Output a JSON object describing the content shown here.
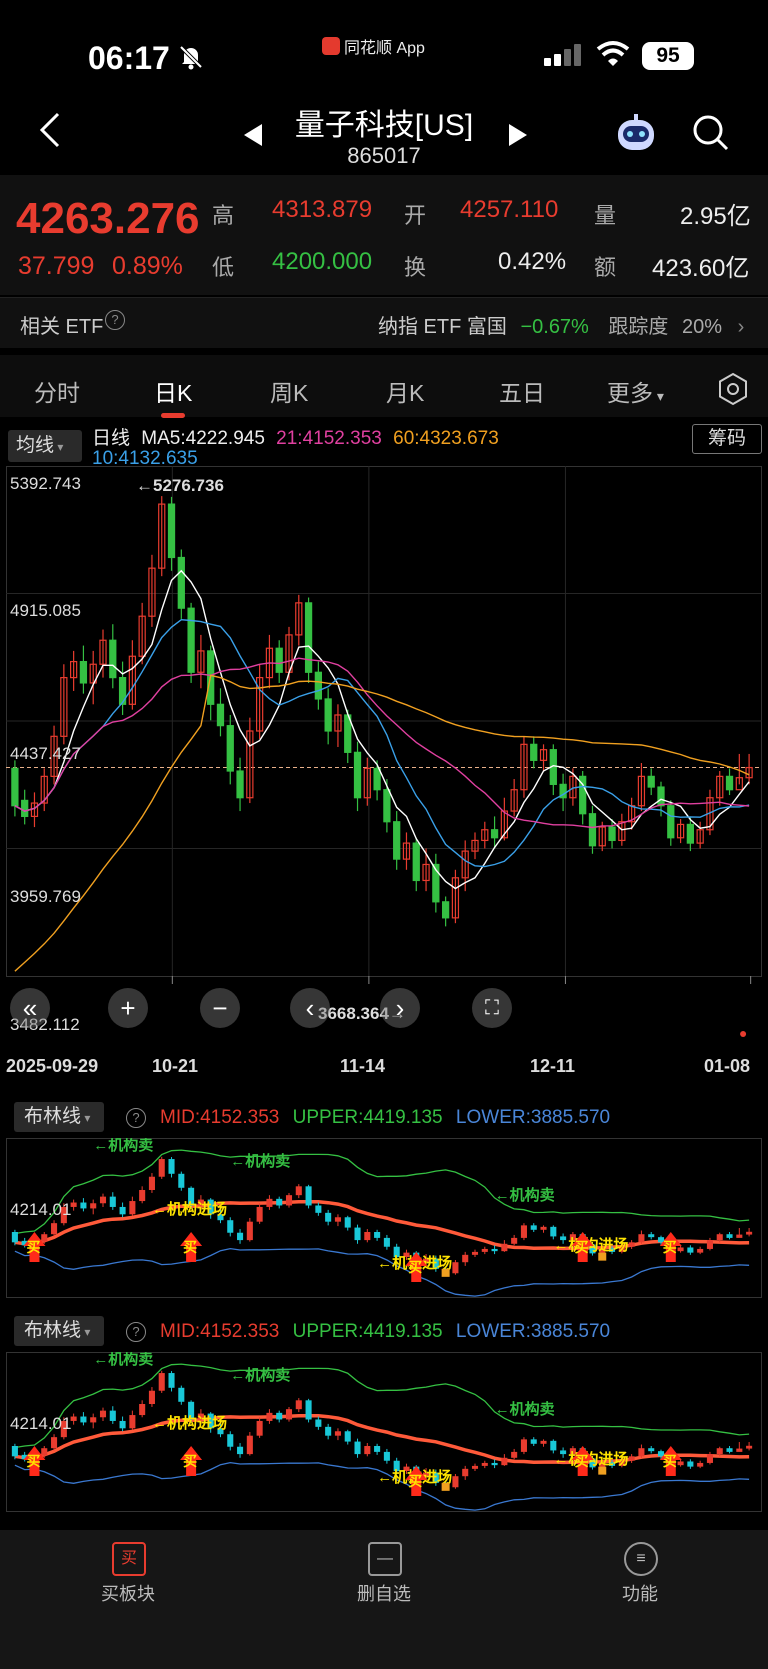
{
  "status": {
    "time": "06:17",
    "app_badge": "同花顺 App",
    "battery": "95"
  },
  "nav": {
    "title": "量子科技[US]",
    "code": "865017"
  },
  "quote": {
    "price": "4263.276",
    "change": "37.799",
    "change_pct": "0.89%",
    "high_label": "高",
    "high": "4313.879",
    "open_label": "开",
    "open": "4257.110",
    "vol_label": "量",
    "vol": "2.95亿",
    "low_label": "低",
    "low": "4200.000",
    "turn_label": "换",
    "turn": "0.42%",
    "amt_label": "额",
    "amt": "423.60亿"
  },
  "etf": {
    "label": "相关 ETF",
    "q": "?",
    "name": "纳指 ETF 富国",
    "pct": "−0.67%",
    "track_label": "跟踪度",
    "track": "20%"
  },
  "tabs": [
    "分时",
    "日K",
    "周K",
    "月K",
    "五日",
    "更多"
  ],
  "ma": {
    "selector": "均线",
    "line_label": "日线",
    "ma5": "MA5:4222.945",
    "ma21": "21:4152.353",
    "ma60": "60:4323.673",
    "ma10": "10:4132.635",
    "chip": "筹码"
  },
  "price_axis": [
    "5392.743",
    "4915.085",
    "4437.427",
    "3959.769",
    "3482.112"
  ],
  "annotations": {
    "high": "←5276.736",
    "low": "3668.364→"
  },
  "x_axis": [
    "2025-09-29",
    "10-21",
    "11-14",
    "12-11",
    "01-08"
  ],
  "indicators": [
    {
      "selector": "布林线",
      "mid": "MID:4152.353",
      "upper": "UPPER:4419.135",
      "lower": "LOWER:3885.570",
      "ylabel": "4214.01",
      "signals": {
        "sell": "←机构卖",
        "enter": "←机构进场",
        "buy": "买"
      }
    },
    {
      "selector": "布林线",
      "mid": "MID:4152.353",
      "upper": "UPPER:4419.135",
      "lower": "LOWER:3885.570",
      "ylabel": "4214.01",
      "signals": {
        "sell": "←机构卖",
        "enter": "←机构进场",
        "buy": "买"
      }
    }
  ],
  "bottom": [
    {
      "label": "买板块",
      "icon": "买"
    },
    {
      "label": "删自选",
      "icon": "—"
    },
    {
      "label": "功能",
      "icon": "≡"
    }
  ],
  "colors": {
    "up": "#e83c2f",
    "down": "#35c043",
    "ma5": "#ffffff",
    "ma10": "#3aa0e8",
    "ma21": "#e040a0",
    "ma60": "#f0a020",
    "cyan": "#19c8d8"
  },
  "chart_data": {
    "type": "candlestick",
    "ylim": [
      3482.112,
      5392.743
    ],
    "x_labels": [
      "2025-09-29",
      "10-21",
      "11-14",
      "12-11",
      "01-08"
    ],
    "candles": [
      [
        4260,
        4120,
        4290,
        4080
      ],
      [
        4140,
        4080,
        4180,
        4050
      ],
      [
        4080,
        4130,
        4170,
        4040
      ],
      [
        4130,
        4230,
        4260,
        4100
      ],
      [
        4230,
        4380,
        4420,
        4200
      ],
      [
        4380,
        4600,
        4650,
        4350
      ],
      [
        4600,
        4660,
        4700,
        4550
      ],
      [
        4660,
        4580,
        4720,
        4540
      ],
      [
        4580,
        4650,
        4700,
        4500
      ],
      [
        4650,
        4740,
        4780,
        4600
      ],
      [
        4740,
        4600,
        4800,
        4560
      ],
      [
        4600,
        4500,
        4660,
        4460
      ],
      [
        4500,
        4680,
        4740,
        4480
      ],
      [
        4680,
        4830,
        4880,
        4650
      ],
      [
        4830,
        5010,
        5060,
        4790
      ],
      [
        5010,
        5250,
        5280,
        4980
      ],
      [
        5250,
        5050,
        5277,
        5000
      ],
      [
        5050,
        4860,
        5080,
        4820
      ],
      [
        4860,
        4620,
        4880,
        4580
      ],
      [
        4620,
        4700,
        4760,
        4560
      ],
      [
        4700,
        4500,
        4720,
        4440
      ],
      [
        4500,
        4420,
        4560,
        4380
      ],
      [
        4420,
        4250,
        4460,
        4200
      ],
      [
        4250,
        4150,
        4300,
        4100
      ],
      [
        4150,
        4400,
        4450,
        4130
      ],
      [
        4400,
        4600,
        4650,
        4370
      ],
      [
        4600,
        4710,
        4760,
        4560
      ],
      [
        4710,
        4620,
        4740,
        4580
      ],
      [
        4620,
        4760,
        4790,
        4590
      ],
      [
        4760,
        4880,
        4910,
        4720
      ],
      [
        4880,
        4620,
        4900,
        4580
      ],
      [
        4620,
        4520,
        4660,
        4480
      ],
      [
        4520,
        4400,
        4560,
        4350
      ],
      [
        4400,
        4460,
        4500,
        4340
      ],
      [
        4460,
        4320,
        4480,
        4280
      ],
      [
        4320,
        4150,
        4360,
        4100
      ],
      [
        4150,
        4260,
        4300,
        4120
      ],
      [
        4260,
        4180,
        4290,
        4140
      ],
      [
        4180,
        4060,
        4220,
        4020
      ],
      [
        4060,
        3920,
        4100,
        3880
      ],
      [
        3920,
        3980,
        4020,
        3880
      ],
      [
        3980,
        3840,
        4000,
        3800
      ],
      [
        3840,
        3900,
        3960,
        3800
      ],
      [
        3900,
        3760,
        3940,
        3720
      ],
      [
        3760,
        3700,
        3780,
        3668
      ],
      [
        3700,
        3850,
        3880,
        3680
      ],
      [
        3850,
        3950,
        3990,
        3800
      ],
      [
        3950,
        3990,
        4020,
        3920
      ],
      [
        3990,
        4030,
        4060,
        3960
      ],
      [
        4030,
        4000,
        4080,
        3960
      ],
      [
        4000,
        4100,
        4150,
        3990
      ],
      [
        4100,
        4180,
        4220,
        4080
      ],
      [
        4180,
        4350,
        4380,
        4150
      ],
      [
        4350,
        4290,
        4380,
        4260
      ],
      [
        4290,
        4330,
        4350,
        4250
      ],
      [
        4330,
        4200,
        4350,
        4160
      ],
      [
        4200,
        4150,
        4240,
        4100
      ],
      [
        4150,
        4230,
        4260,
        4120
      ],
      [
        4230,
        4090,
        4250,
        4050
      ],
      [
        4090,
        3970,
        4120,
        3940
      ],
      [
        3970,
        4040,
        4060,
        3950
      ],
      [
        4040,
        3990,
        4070,
        3960
      ],
      [
        3990,
        4060,
        4090,
        3970
      ],
      [
        4060,
        4120,
        4150,
        4030
      ],
      [
        4120,
        4230,
        4280,
        4100
      ],
      [
        4230,
        4190,
        4260,
        4160
      ],
      [
        4190,
        4120,
        4210,
        4080
      ],
      [
        4120,
        4000,
        4140,
        3970
      ],
      [
        4000,
        4050,
        4070,
        3980
      ],
      [
        4050,
        3980,
        4080,
        3950
      ],
      [
        3980,
        4030,
        4060,
        3960
      ],
      [
        4030,
        4150,
        4180,
        4010
      ],
      [
        4150,
        4230,
        4250,
        4120
      ],
      [
        4230,
        4180,
        4260,
        4160
      ],
      [
        4180,
        4225,
        4314,
        4200
      ],
      [
        4225,
        4263,
        4314,
        4200
      ]
    ]
  }
}
